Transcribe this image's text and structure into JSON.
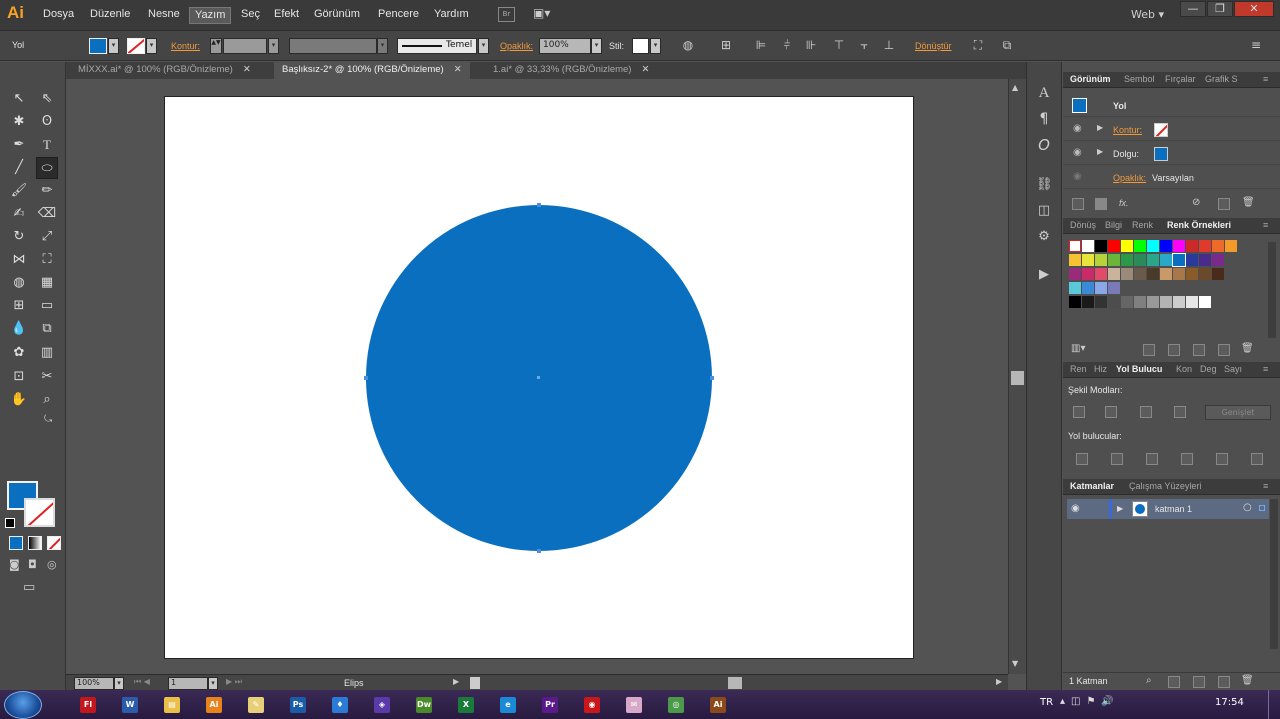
{
  "menu": {
    "logo": "Ai",
    "items": [
      "Dosya",
      "Düzenle",
      "Nesne",
      "Yazım",
      "Seç",
      "Efekt",
      "Görünüm",
      "Pencere",
      "Yardım"
    ],
    "active": "Yazım",
    "bridge": "Br",
    "workspace": "Web ▾",
    "window_buttons": [
      "—",
      "❐",
      "✕"
    ]
  },
  "control": {
    "selection": "Yol",
    "stroke_label": "Kontur:",
    "brush_label": "Temel",
    "opacity_label": "Opaklık:",
    "opacity_value": "100%",
    "style_label": "Stil:",
    "transform_label": "Dönüştür"
  },
  "tabs": [
    {
      "label": "MİXXX.ai* @ 100% (RGB/Önizleme)",
      "close": "✕"
    },
    {
      "label": "Başlıksız-2* @ 100% (RGB/Önizleme)",
      "close": "✕"
    },
    {
      "label": "1.ai* @ 33,33% (RGB/Önizleme)",
      "close": "✕"
    }
  ],
  "status": {
    "zoom": "100%",
    "page": "1",
    "tool_name": "Elips"
  },
  "appearance": {
    "tabs": [
      "Görünüm",
      "Sembol",
      "Fırçalar",
      "Grafik S"
    ],
    "title": "Yol",
    "stroke_label": "Kontur:",
    "fill_label": "Dolgu:",
    "opacity_label": "Opaklık:",
    "opacity_value": "Varsayılan"
  },
  "swatches": {
    "tabs": [
      "Dönüş",
      "Bilgi",
      "Renk",
      "Renk Örnekleri"
    ],
    "rows": [
      [
        "#ffffff",
        "#ffffff",
        "#000000",
        "#ff0000",
        "#ffff00",
        "#00ff00",
        "#00ffff",
        "#0000ff",
        "#ff00ff",
        "#cc2a2a",
        "#e23a2a",
        "#ee6a2a",
        "#f49a2a"
      ],
      [
        "#f6c232",
        "#e8e43a",
        "#b6d43a",
        "#6ab63a",
        "#2a9a4a",
        "#2a8a5a",
        "#2aa68a",
        "#2aa8c8",
        "#0a6fbf",
        "#2a3a9a",
        "#4a2a8a",
        "#7a2a8a"
      ],
      [
        "#9a2a7a",
        "#c82a6a",
        "#e24a6a",
        "#c8b49a",
        "#9a8a7a",
        "#6a5a4a",
        "#4a3a2a",
        "#c89a6a",
        "#a8784a",
        "#8a5a2a",
        "#6a4a2a",
        "#4a2a1a"
      ],
      [
        "#5ac8d8",
        "#3a8ad8",
        "#8aa8e8",
        "#7a7ab8"
      ],
      [
        "#000000",
        "#1a1a1a",
        "#333333",
        "#4d4d4d",
        "#666666",
        "#808080",
        "#999999",
        "#b3b3b3",
        "#cccccc",
        "#e6e6e6",
        "#ffffff"
      ]
    ]
  },
  "pathfinder": {
    "tabs": [
      "Ren",
      "Hiz",
      "Yol Bulucu",
      "Kon",
      "Deg",
      "Sayı"
    ],
    "shape_modes": "Şekil Modları:",
    "expand": "Genişlet",
    "pathfinders": "Yol bulucular:"
  },
  "layers": {
    "tabs": [
      "Katmanlar",
      "Çalışma Yüzeyleri"
    ],
    "layer_name": "katman 1",
    "count": "1 Katman"
  },
  "taskbar": {
    "lang": "TR",
    "time": "17:54",
    "apps": [
      {
        "name": "flash",
        "label": "Fl",
        "color": "#c0181c"
      },
      {
        "name": "word",
        "label": "W",
        "color": "#2a5caa"
      },
      {
        "name": "explorer",
        "label": "▤",
        "color": "#e8c04a"
      },
      {
        "name": "illustrator",
        "label": "Ai",
        "color": "#e8821a"
      },
      {
        "name": "notes",
        "label": "✎",
        "color": "#e8d07a"
      },
      {
        "name": "photoshop",
        "label": "Ps",
        "color": "#1a5ca8"
      },
      {
        "name": "paint",
        "label": "♦",
        "color": "#2a7ad8"
      },
      {
        "name": "app",
        "label": "◈",
        "color": "#5a3aa8"
      },
      {
        "name": "dreamweaver",
        "label": "Dw",
        "color": "#4a8a2a"
      },
      {
        "name": "excel",
        "label": "X",
        "color": "#1a7a3a"
      },
      {
        "name": "ie",
        "label": "e",
        "color": "#1a8ad8"
      },
      {
        "name": "premiere",
        "label": "Pr",
        "color": "#5a1a8a"
      },
      {
        "name": "acrobat",
        "label": "◉",
        "color": "#c8181a"
      },
      {
        "name": "app2",
        "label": "✉",
        "color": "#d8a8c8"
      },
      {
        "name": "chrome",
        "label": "◎",
        "color": "#4a9a4a"
      },
      {
        "name": "illustrator2",
        "label": "Ai",
        "color": "#8a4a1a"
      }
    ]
  },
  "colors": {
    "fill": "#0a6fbf",
    "accent": "#f29a3a"
  }
}
